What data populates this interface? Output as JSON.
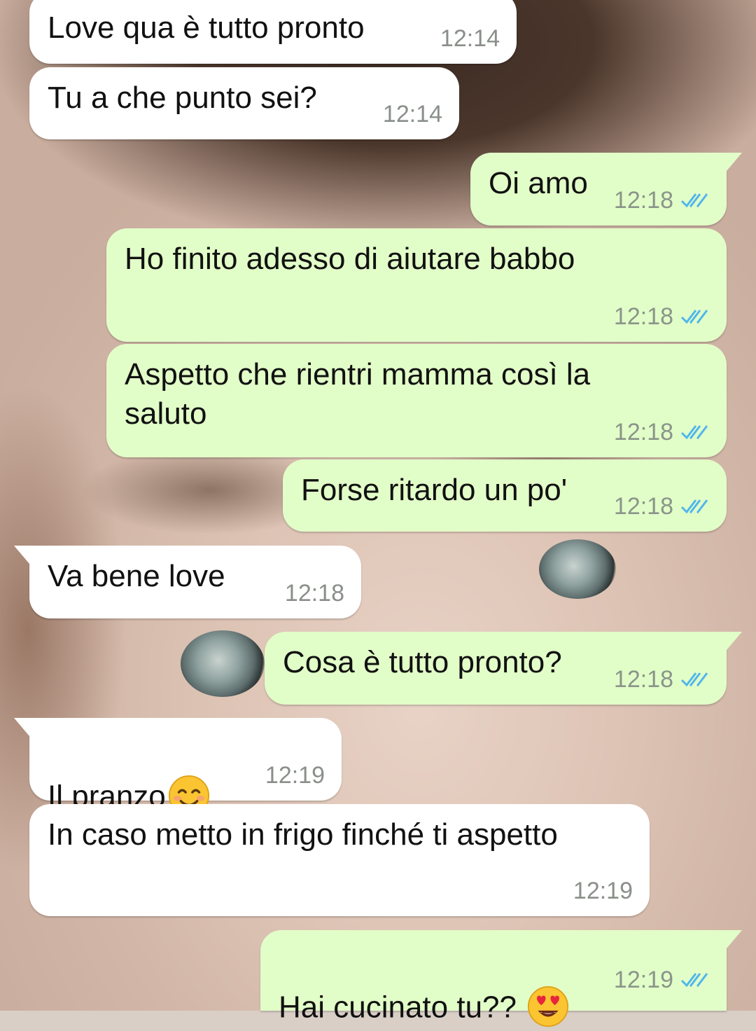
{
  "conversation": {
    "messages": [
      {
        "dir": "in",
        "text": "Love qua è tutto pronto",
        "time": "12:14"
      },
      {
        "dir": "in",
        "text": "Tu a che punto sei?",
        "time": "12:14"
      },
      {
        "dir": "out",
        "text": "Oi amo",
        "time": "12:18",
        "status": "read"
      },
      {
        "dir": "out",
        "text": "Ho finito adesso di aiutare babbo",
        "time": "12:18",
        "status": "read"
      },
      {
        "dir": "out",
        "text": "Aspetto che rientri mamma così la\nsaluto",
        "time": "12:18",
        "status": "read"
      },
      {
        "dir": "out",
        "text": "Forse ritardo un po'",
        "time": "12:18",
        "status": "read"
      },
      {
        "dir": "in",
        "text": "Va bene love",
        "time": "12:18"
      },
      {
        "dir": "out",
        "text": "Cosa è tutto pronto?",
        "time": "12:18",
        "status": "read"
      },
      {
        "dir": "in",
        "text": "Il pranzo",
        "emoji": "smiling-face-icon",
        "time": "12:19"
      },
      {
        "dir": "in",
        "text": "In caso metto in frigo finché ti aspetto",
        "time": "12:19"
      },
      {
        "dir": "out",
        "text": "Hai cucinato tu??",
        "emoji": "heart-eyes-face-icon",
        "time": "12:19",
        "status": "read"
      }
    ]
  },
  "colors": {
    "incoming_bubble": "#ffffff",
    "outgoing_bubble": "#e2fec8",
    "read_ticks": "#4fb6ec",
    "timestamp": "#8a8f8a"
  }
}
